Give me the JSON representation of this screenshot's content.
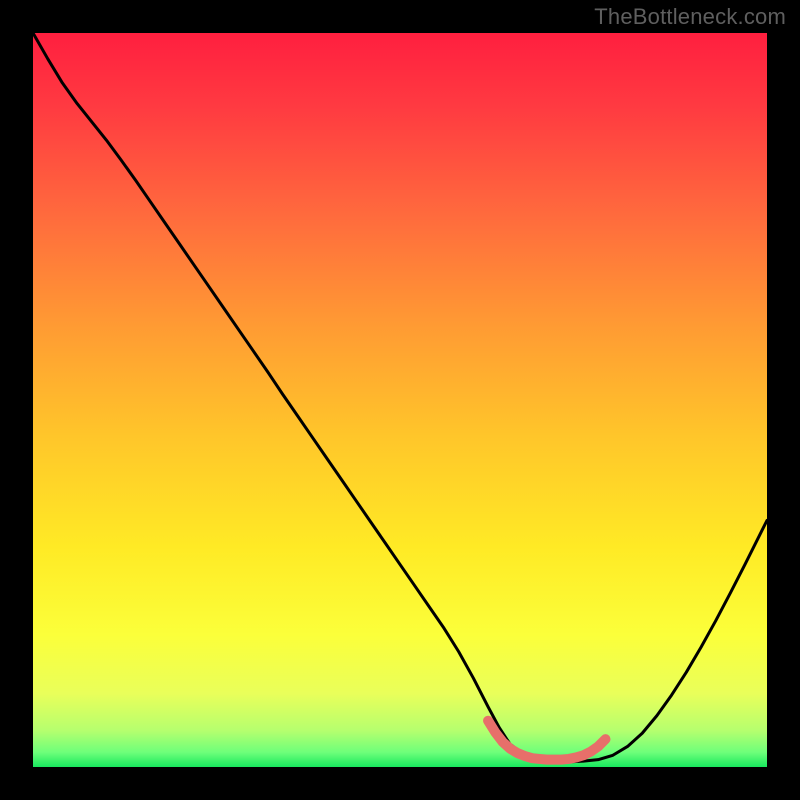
{
  "watermark": "TheBottleneck.com",
  "colors": {
    "curve": "#000000",
    "highlight": "#e76f6a",
    "background_top": "#ff1f3f",
    "background_bottom": "#18e85e"
  },
  "chart_data": {
    "type": "line",
    "title": "",
    "xlabel": "",
    "ylabel": "",
    "xlim": [
      0,
      100
    ],
    "ylim": [
      0,
      100
    ],
    "x": [
      0,
      2,
      4,
      6,
      8,
      10,
      12,
      14,
      16,
      18,
      20,
      22,
      24,
      26,
      28,
      30,
      32,
      34,
      36,
      38,
      40,
      42,
      44,
      46,
      48,
      50,
      52,
      54,
      56,
      58,
      60,
      62,
      63.5,
      65,
      67,
      69,
      71,
      73,
      75,
      77,
      79,
      81,
      83,
      85,
      87,
      89,
      91,
      93,
      95,
      97,
      99,
      100
    ],
    "values": [
      100,
      96.5,
      93.2,
      90.4,
      87.9,
      85.4,
      82.7,
      79.9,
      77.0,
      74.1,
      71.2,
      68.3,
      65.4,
      62.5,
      59.6,
      56.7,
      53.8,
      50.8,
      47.9,
      45.0,
      42.1,
      39.2,
      36.3,
      33.4,
      30.5,
      27.6,
      24.7,
      21.8,
      18.9,
      15.7,
      12.1,
      8.2,
      5.4,
      3.1,
      1.6,
      0.9,
      0.7,
      0.7,
      0.8,
      1.0,
      1.6,
      2.8,
      4.6,
      7.0,
      9.8,
      12.9,
      16.3,
      19.9,
      23.7,
      27.6,
      31.6,
      33.6
    ],
    "highlight_segment": {
      "x": [
        62.0,
        63.0,
        64.0,
        65.0,
        66.0,
        67.0,
        68.0,
        69.0,
        70.0,
        71.0,
        72.0,
        73.0,
        74.0,
        75.0,
        76.0,
        77.0,
        78.0
      ],
      "values": [
        6.3,
        4.7,
        3.4,
        2.5,
        1.9,
        1.5,
        1.2,
        1.1,
        1.0,
        1.0,
        1.0,
        1.1,
        1.3,
        1.6,
        2.1,
        2.8,
        3.8
      ]
    }
  }
}
